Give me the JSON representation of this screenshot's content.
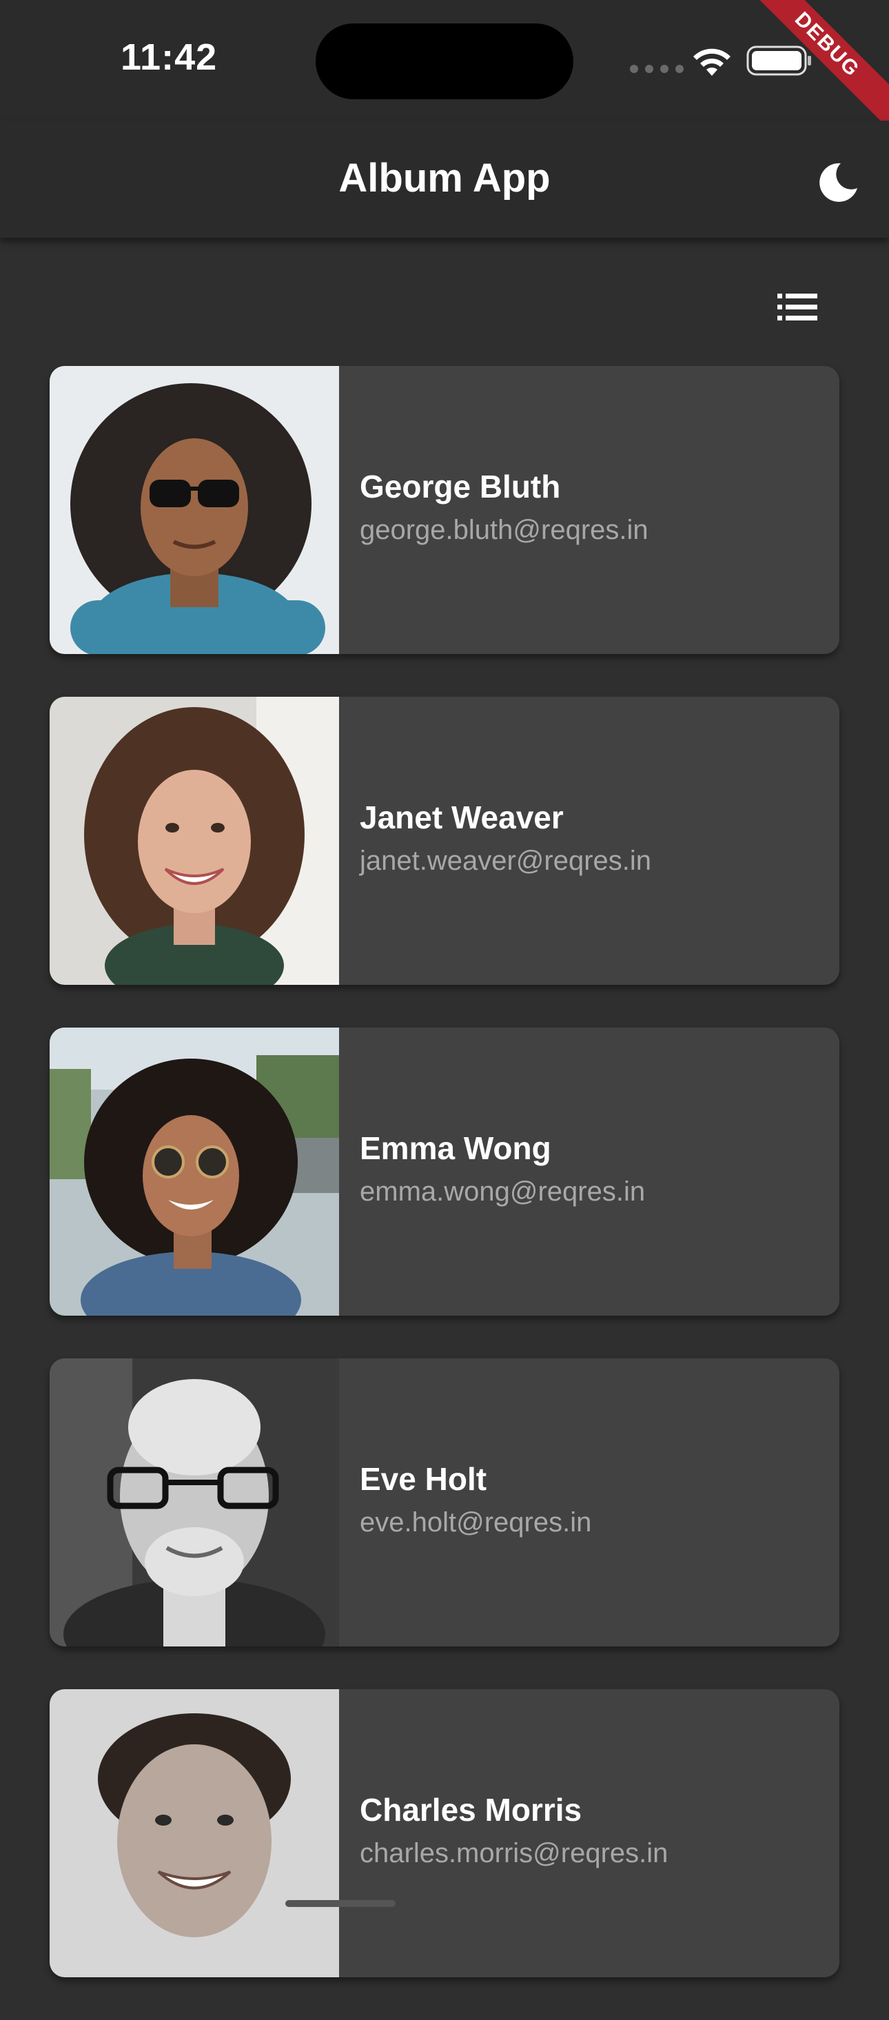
{
  "status_bar": {
    "time": "11:42",
    "wifi_icon": "wifi-icon",
    "battery_icon": "battery-icon"
  },
  "debug_banner": "DEBUG",
  "app_bar": {
    "title": "Album App",
    "theme_icon": "moon-icon"
  },
  "toolbar": {
    "view_toggle_icon": "list-view-icon"
  },
  "users": [
    {
      "name": "George Bluth",
      "email": "george.bluth@reqres.in"
    },
    {
      "name": "Janet Weaver",
      "email": "janet.weaver@reqres.in"
    },
    {
      "name": "Emma Wong",
      "email": "emma.wong@reqres.in"
    },
    {
      "name": "Eve Holt",
      "email": "eve.holt@reqres.in"
    },
    {
      "name": "Charles Morris",
      "email": "charles.morris@reqres.in"
    }
  ],
  "colors": {
    "background": "#2f2f2f",
    "app_bar": "#2b2b2b",
    "card": "#424242",
    "email_text": "#a8a8a8",
    "debug_ribbon": "#b3212d"
  }
}
